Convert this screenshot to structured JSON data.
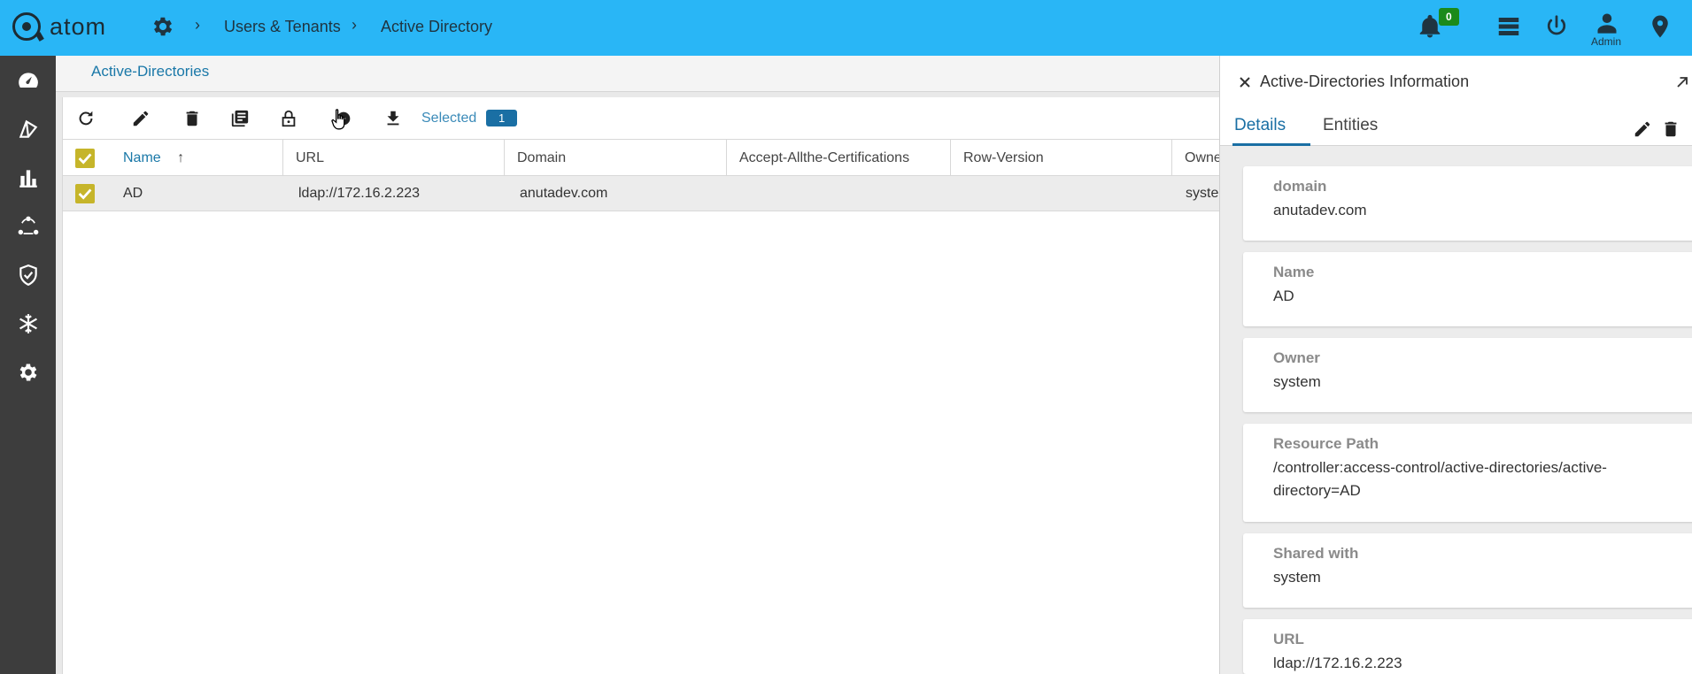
{
  "app": {
    "logo_text": "atom",
    "breadcrumb": [
      "Users & Tenants",
      "Active Directory"
    ],
    "notification_count": "0",
    "user_label": "Admin"
  },
  "sidebar": {
    "items": [
      {
        "icon": "dashboard-icon"
      },
      {
        "icon": "resources-icon"
      },
      {
        "icon": "analytics-icon"
      },
      {
        "icon": "topology-icon"
      },
      {
        "icon": "compliance-icon"
      },
      {
        "icon": "snowflake-icon"
      },
      {
        "icon": "settings-icon"
      }
    ]
  },
  "main": {
    "page_title": "Active-Directories",
    "selected_label": "Selected",
    "selected_count": "1",
    "columns": [
      "Name",
      "URL",
      "Domain",
      "Accept-Allthe-Certifications",
      "Row-Version",
      "Owne"
    ],
    "rows": [
      {
        "name": "AD",
        "url": "ldap://172.16.2.223",
        "domain": "anutadev.com",
        "accept": "",
        "row_version": "",
        "owner": "syste"
      }
    ]
  },
  "panel": {
    "title": "Active-Directories Information",
    "tabs": [
      "Details",
      "Entities"
    ],
    "fields": [
      {
        "label": "domain",
        "value": "anutadev.com"
      },
      {
        "label": "Name",
        "value": "AD"
      },
      {
        "label": "Owner",
        "value": "system"
      },
      {
        "label": "Resource Path",
        "value": "/controller:access-control/active-directories/active-directory=AD"
      },
      {
        "label": "Shared with",
        "value": "system"
      },
      {
        "label": "URL",
        "value": "ldap://172.16.2.223"
      }
    ]
  },
  "colors": {
    "topbar": "#29b6f6",
    "sidebar": "#3d3d3d",
    "accent": "#1a6fa4",
    "checkbox": "#c6b52a",
    "badge": "#1b8a1b"
  }
}
